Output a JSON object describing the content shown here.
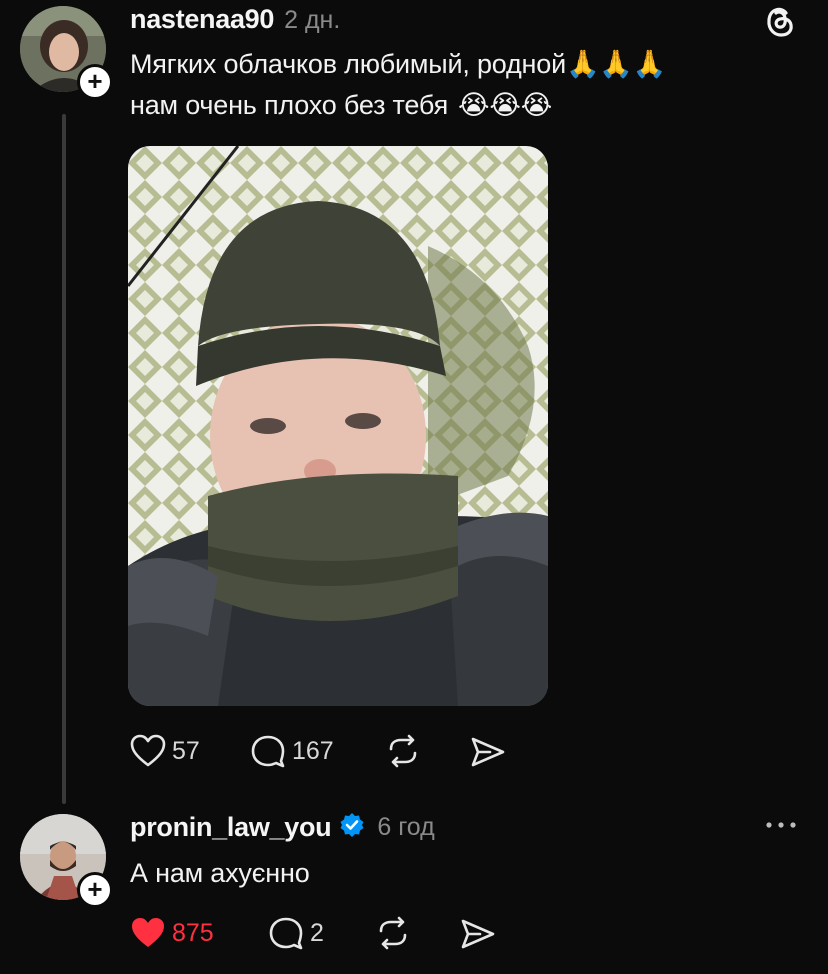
{
  "post": {
    "username": "nastenaa90",
    "time": "2 дн.",
    "line1": "Мягких облачков любимый, родной",
    "line1_emoji": "🙏🙏🙏",
    "line2": "нам очень плохо без тебя",
    "line2_emoji": "😭😭😭",
    "likes": "57",
    "replies": "167"
  },
  "reply": {
    "username": "pronin_law_you",
    "time": "6 год",
    "text": "А нам ахуєнно",
    "likes": "875",
    "replies": "2"
  },
  "colors": {
    "background": "#0b0b0b",
    "like_active": "#ff3040",
    "verified": "#0095f6"
  }
}
